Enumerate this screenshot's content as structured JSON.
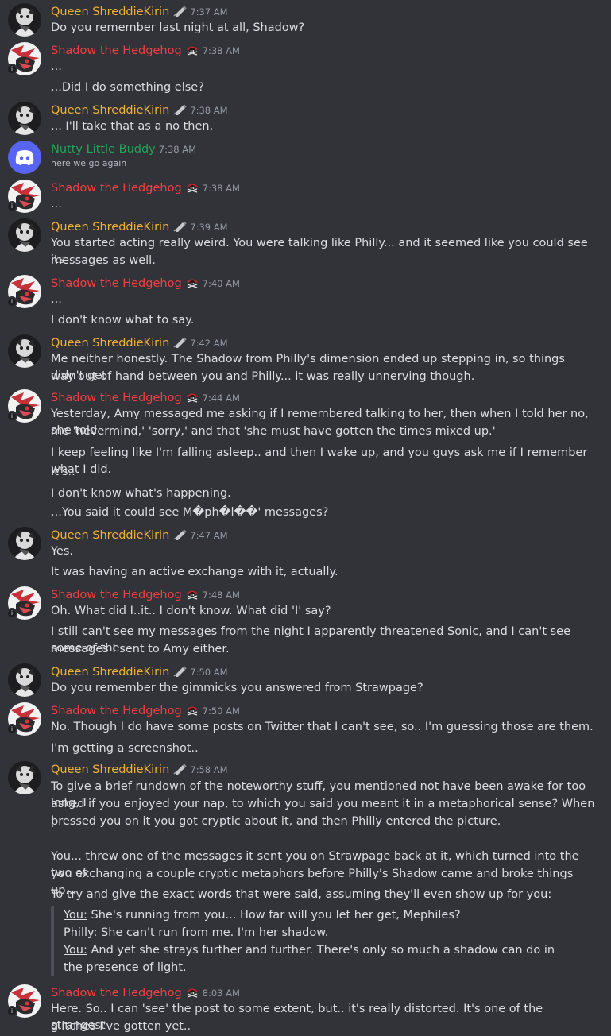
{
  "colors": {
    "background": "#313338",
    "queen": "#f0b232",
    "shadow": "#f23f43",
    "nutty": "#23a559",
    "text": "#dbdee1",
    "muted": "#949ba4",
    "discord_blurple": "#5865f2"
  },
  "icons": {
    "queen_tag": "syringe-icon",
    "shadow_tag": "pirate-skull-icon",
    "nutty_avatar": "discord-logo-icon"
  },
  "messages": [
    {
      "author": "Queen ShreddieKirin",
      "time": "7:37 AM",
      "lines": [
        "Do you remember last night at all, Shadow?"
      ]
    },
    {
      "author": "Shadow the Hedgehog",
      "time": "7:38 AM",
      "lines": [
        "...",
        "...Did I do something else?"
      ]
    },
    {
      "author": "Queen ShreddieKirin",
      "time": "7:38 AM",
      "lines": [
        "... I'll take that as a no then."
      ]
    },
    {
      "author": "Nutty Little Buddy",
      "time": "7:38 AM",
      "lines": [
        "here we go again"
      ]
    },
    {
      "author": "Shadow the Hedgehog",
      "time": "7:38 AM",
      "lines": [
        "..."
      ]
    },
    {
      "author": "Queen ShreddieKirin",
      "time": "7:39 AM",
      "lines": [
        "You started acting really weird. You were talking like Philly... and it seemed like you could see its",
        "messages as well."
      ]
    },
    {
      "author": "Shadow the Hedgehog",
      "time": "7:40 AM",
      "lines": [
        "...",
        "I don't know what to say."
      ]
    },
    {
      "author": "Queen ShreddieKirin",
      "time": "7:42 AM",
      "lines": [
        "Me neither honestly. The Shadow from Philly's dimension ended up stepping in, so things didn't get",
        "way out of hand between you and Philly... it was really unnerving though."
      ]
    },
    {
      "author": "Shadow the Hedgehog",
      "time": "7:44 AM",
      "lines": [
        "Yesterday, Amy messaged me asking if I remembered talking to her, then when I told her no, she told",
        "me 'nevermind,' 'sorry,' and that 'she must have gotten the times mixed up.'",
        "I keep feeling like I'm falling asleep.. and then I wake up, and you guys ask me if I remember what I did.",
        "It's..",
        "I don't know what's happening.",
        "...You said it could see M�ph�l��' messages?"
      ]
    },
    {
      "author": "Queen ShreddieKirin",
      "time": "7:47 AM",
      "lines": [
        "Yes.",
        "It was having an active exchange with it, actually."
      ]
    },
    {
      "author": "Shadow the Hedgehog",
      "time": "7:48 AM",
      "lines": [
        "Oh. What did I..it.. I don't know. What did 'I' say?",
        "I still can't see my messages from the night I apparently threatened Sonic, and I can't see some of the",
        "messages I sent to Amy either."
      ]
    },
    {
      "author": "Queen ShreddieKirin",
      "time": "7:50 AM",
      "lines": [
        "Do you remember the gimmicks you answered from Strawpage?"
      ]
    },
    {
      "author": "Shadow the Hedgehog",
      "time": "7:50 AM",
      "lines": [
        "No. Though I do have some posts on Twitter that I can't see, so.. I'm guessing those are them.",
        "I'm getting a screenshot.."
      ]
    },
    {
      "author": "Queen ShreddieKirin",
      "time": "7:58 AM",
      "lines": [
        "To give a brief rundown of the noteworthy stuff, you mentioned not have been awake for too long, I",
        "asked if you enjoyed your nap, to which you said you meant it in a metaphorical sense? When I",
        "pressed you on it you got cryptic about it, and then Philly entered the picture.",
        "You... threw one of the messages it sent you on Strawpage back at it, which turned into the two of",
        "you exchanging a couple cryptic metaphors before Philly's Shadow came and broke things up...",
        "To try and give the exact words that were said, assuming they'll even show up for you:"
      ],
      "quote": [
        {
          "speaker": "You:",
          "text": " She's running from you... How far will you let her get, Mephiles?"
        },
        {
          "speaker": "Philly:",
          "text": " She can't run from me. I'm her shadow."
        },
        {
          "speaker": "You:",
          "text": " And yet she strays further and further. There's only so much a shadow can do in"
        },
        {
          "speaker": "",
          "text": "the presence of light."
        }
      ]
    },
    {
      "author": "Shadow the Hedgehog",
      "time": "8:03 AM",
      "lines": [
        "Here. So.. I can 'see' the post to some extent, but.. it's really distorted. It's one of the strangest",
        "glitches I've gotten yet.."
      ]
    }
  ]
}
